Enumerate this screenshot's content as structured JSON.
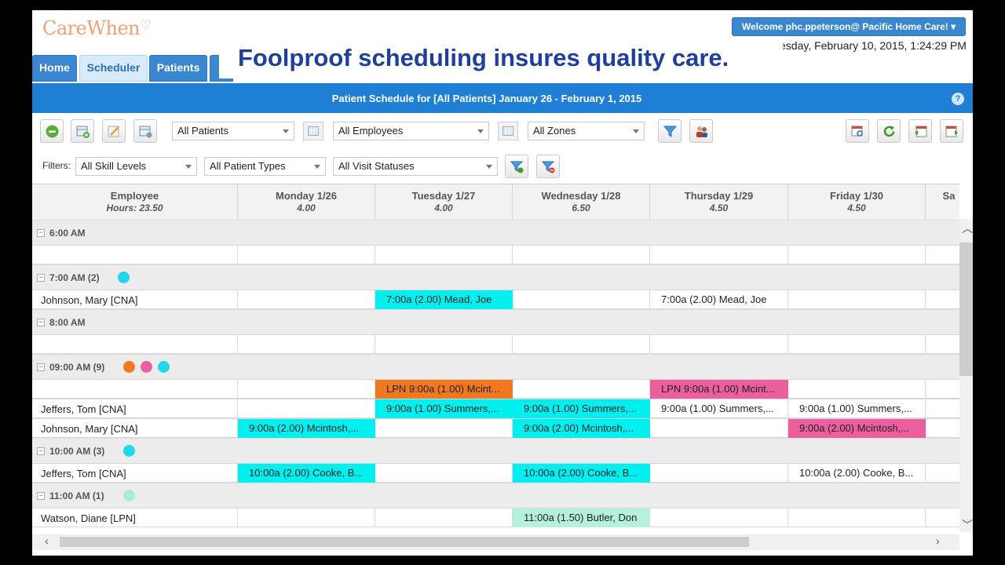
{
  "header": {
    "logo": "CareWhen",
    "welcome": "Welcome phc.ppeterson@ Pacific Home Care!",
    "datetime": "esday, February 10, 2015, 1:24:29 PM",
    "overlay": "Foolproof scheduling insures quality care."
  },
  "tabs": [
    {
      "label": "Home"
    },
    {
      "label": "Scheduler"
    },
    {
      "label": "Patients"
    }
  ],
  "title_bar": {
    "text": "Patient Schedule for [All Patients] January 26 - February 1, 2015"
  },
  "toolbar": {
    "patients_select": "All Patients",
    "employees_select": "All Employees",
    "zones_select": "All Zones"
  },
  "filters": {
    "label": "Filters:",
    "skill": "All Skill Levels",
    "patient_types": "All Patient Types",
    "visit_statuses": "All Visit Statuses"
  },
  "columns": [
    {
      "name": "Employee",
      "sub": "Hours: 23.50"
    },
    {
      "name": "Monday 1/26",
      "sub": "4.00"
    },
    {
      "name": "Tuesday 1/27",
      "sub": "4.00"
    },
    {
      "name": "Wednesday 1/28",
      "sub": "6.50"
    },
    {
      "name": "Thursday 1/29",
      "sub": "4.50"
    },
    {
      "name": "Friday 1/30",
      "sub": "4.50"
    },
    {
      "name": "Sa",
      "sub": ""
    }
  ],
  "groups": [
    {
      "label": "6:00 AM",
      "rows": [
        {
          "employee": "",
          "cells": [
            "",
            "",
            "",
            "",
            "",
            ""
          ]
        }
      ]
    },
    {
      "label": "7:00 AM (2)",
      "dots": [
        "#22d8e8"
      ],
      "rows": [
        {
          "employee": "Johnson, Mary [CNA]",
          "cells": [
            "",
            "7:00a (2.00) Mead, Joe",
            "",
            "7:00a (2.00) Mead, Joe",
            "",
            ""
          ]
        }
      ]
    },
    {
      "label": "8:00 AM",
      "rows": [
        {
          "employee": "",
          "cells": [
            "",
            "",
            "",
            "",
            "",
            ""
          ]
        }
      ]
    },
    {
      "label": "09:00 AM (9)",
      "dots": [
        "#f07820",
        "#e860a0",
        "#22d8e8"
      ],
      "rows": [
        {
          "employee": "",
          "cells": [
            "",
            "LPN  9:00a (1.00) Mcint...",
            "",
            "LPN  9:00a (1.00) Mcint...",
            "",
            ""
          ]
        },
        {
          "employee": "Jeffers, Tom [CNA]",
          "cells": [
            "",
            "9:00a (1.00) Summers,...",
            "9:00a (1.00) Summers,...",
            "9:00a (1.00) Summers,...",
            "9:00a (1.00) Summers,...",
            ""
          ]
        },
        {
          "employee": "Johnson, Mary [CNA]",
          "cells": [
            "9:00a (2.00) Mcintosh,...",
            "",
            "9:00a (2.00) Mcintosh,...",
            "",
            "9:00a (2.00) Mcintosh,...",
            ""
          ]
        }
      ]
    },
    {
      "label": "10:00 AM (3)",
      "dots": [
        "#22d8e8"
      ],
      "rows": [
        {
          "employee": "Jeffers, Tom [CNA]",
          "cells": [
            "10:00a (2.00) Cooke, B...",
            "",
            "10:00a (2.00) Cooke, B...",
            "",
            "10:00a (2.00) Cooke, B...",
            ""
          ]
        }
      ]
    },
    {
      "label": "11:00 AM (1)",
      "dots": [
        "#a8ecd8"
      ],
      "rows": [
        {
          "employee": "Watson, Diane [LPN]",
          "cells": [
            "",
            "",
            "11:00a (1.50) Butler, Don",
            "",
            "",
            ""
          ]
        }
      ]
    }
  ],
  "colors": {
    "cyan": "#00f0f0",
    "orange": "#f07820",
    "pink": "#ec5f9f",
    "mint": "#b4f0dc",
    "brand_blue": "#1e7fd5"
  },
  "icons": [
    "remove-icon",
    "add-calendar-icon",
    "edit-icon",
    "calendar-settings-icon",
    "filter-icon",
    "users-icon",
    "calendar-search-icon",
    "refresh-icon",
    "prev-week-icon",
    "next-week-icon",
    "filter-apply-icon",
    "filter-clear-icon",
    "help-icon"
  ]
}
